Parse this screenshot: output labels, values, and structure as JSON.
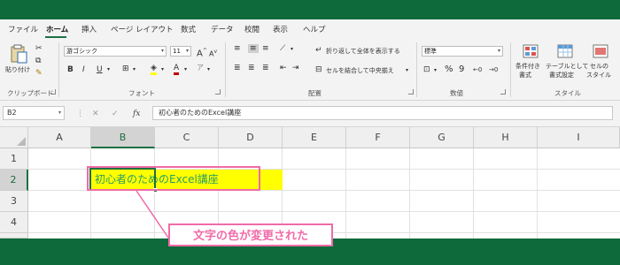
{
  "ribbon_tabs": [
    "ファイル",
    "ホーム",
    "挿入",
    "ページ レイアウト",
    "数式",
    "データ",
    "校閲",
    "表示",
    "ヘルプ"
  ],
  "clipboard": {
    "paste_label": "貼り付け",
    "group_label": "クリップボード"
  },
  "font": {
    "name": "游ゴシック",
    "size": "11",
    "grow_label": "A",
    "shrink_label": "A",
    "bold": "B",
    "italic": "I",
    "underline": "U",
    "font_color_label": "A",
    "group_label": "フォント"
  },
  "alignment": {
    "wrap_text_label": "折り返して全体を表示する",
    "merge_center_label": "セルを結合して中央揃え",
    "group_label": "配置"
  },
  "number": {
    "format": "標準",
    "percent": "%",
    "comma": "9",
    "group_label": "数値"
  },
  "styles": {
    "conditional_label_1": "条件付き",
    "conditional_label_2": "書式",
    "table_label_1": "テーブルとして",
    "table_label_2": "書式設定",
    "cell_styles_label_1": "セルの",
    "cell_styles_label_2": "スタイル",
    "group_label": "スタイル"
  },
  "formula_bar": {
    "name_box": "B2",
    "cancel_label": "✕",
    "enter_label": "✓",
    "fx_label": "fx",
    "content": "初心者のためのExcel講座"
  },
  "grid": {
    "columns": [
      "A",
      "B",
      "C",
      "D",
      "E",
      "F",
      "G",
      "H",
      "I"
    ],
    "rows": [
      "1",
      "2",
      "3",
      "4"
    ],
    "selected_column": "B",
    "selected_row": "2",
    "cell_b2": "初心者のためのExcel講座",
    "cell_b2_fill": "#ffff00",
    "cell_b2_font_color": "#2c9e63"
  },
  "annotation": {
    "text": "文字の色が変更された",
    "color": "#f06ba8"
  },
  "colors": {
    "window_band": "#0e6a3b",
    "accent": "#1d7044",
    "annotation": "#f06ba8"
  }
}
